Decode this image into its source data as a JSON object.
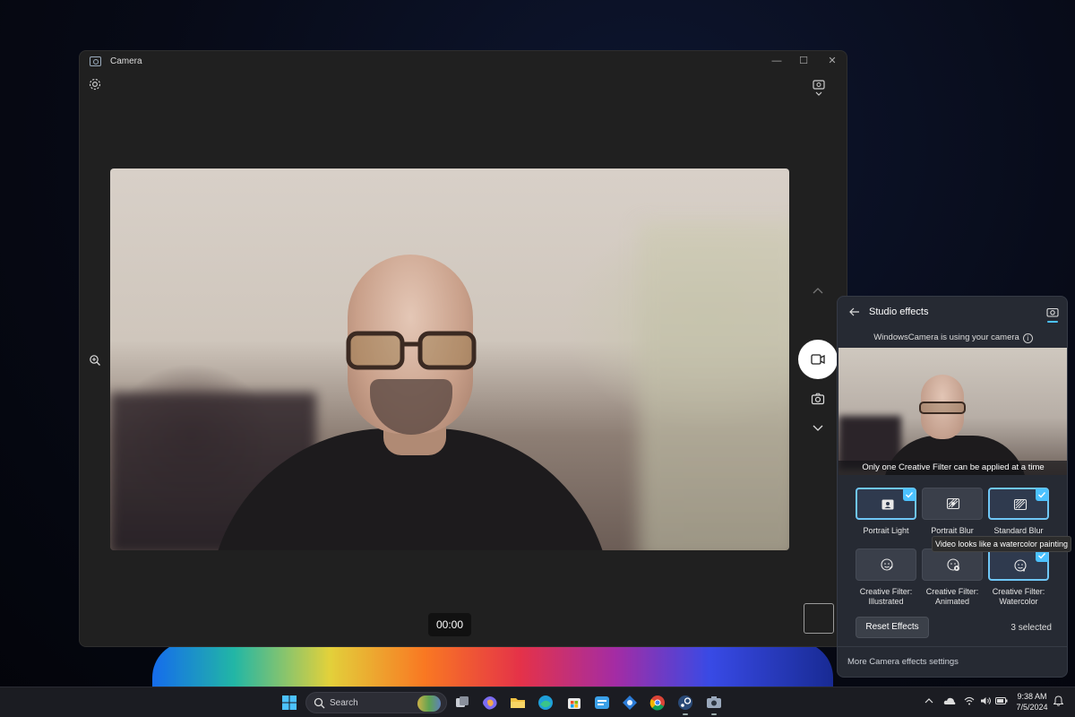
{
  "camera_window": {
    "title": "Camera",
    "timer": "00:00",
    "controls": {
      "minimize": "—",
      "maximize": "☐",
      "close": "✕"
    }
  },
  "studio_effects": {
    "title": "Studio effects",
    "info_text": "WindowsCamera is using your camera",
    "info_icon": "i",
    "preview_caption": "Only one Creative Filter can be applied at a time",
    "tiles": [
      {
        "label": "Portrait Light",
        "selected": true
      },
      {
        "label": "Portrait Blur",
        "selected": false
      },
      {
        "label": "Standard Blur",
        "selected": true
      },
      {
        "label_line1": "Creative Filter:",
        "label_line2": "Illustrated",
        "selected": false
      },
      {
        "label_line1": "Creative Filter:",
        "label_line2": "Animated",
        "selected": false
      },
      {
        "label_line1": "Creative Filter:",
        "label_line2": "Watercolor",
        "selected": true
      }
    ],
    "tooltip": "Video looks like a watercolor painting",
    "reset_label": "Reset Effects",
    "selected_count": "3 selected",
    "more_settings": "More Camera effects settings",
    "accent": "#4cc2ff"
  },
  "taskbar": {
    "search_placeholder": "Search",
    "time": "9:38 AM",
    "date": "7/5/2024"
  }
}
